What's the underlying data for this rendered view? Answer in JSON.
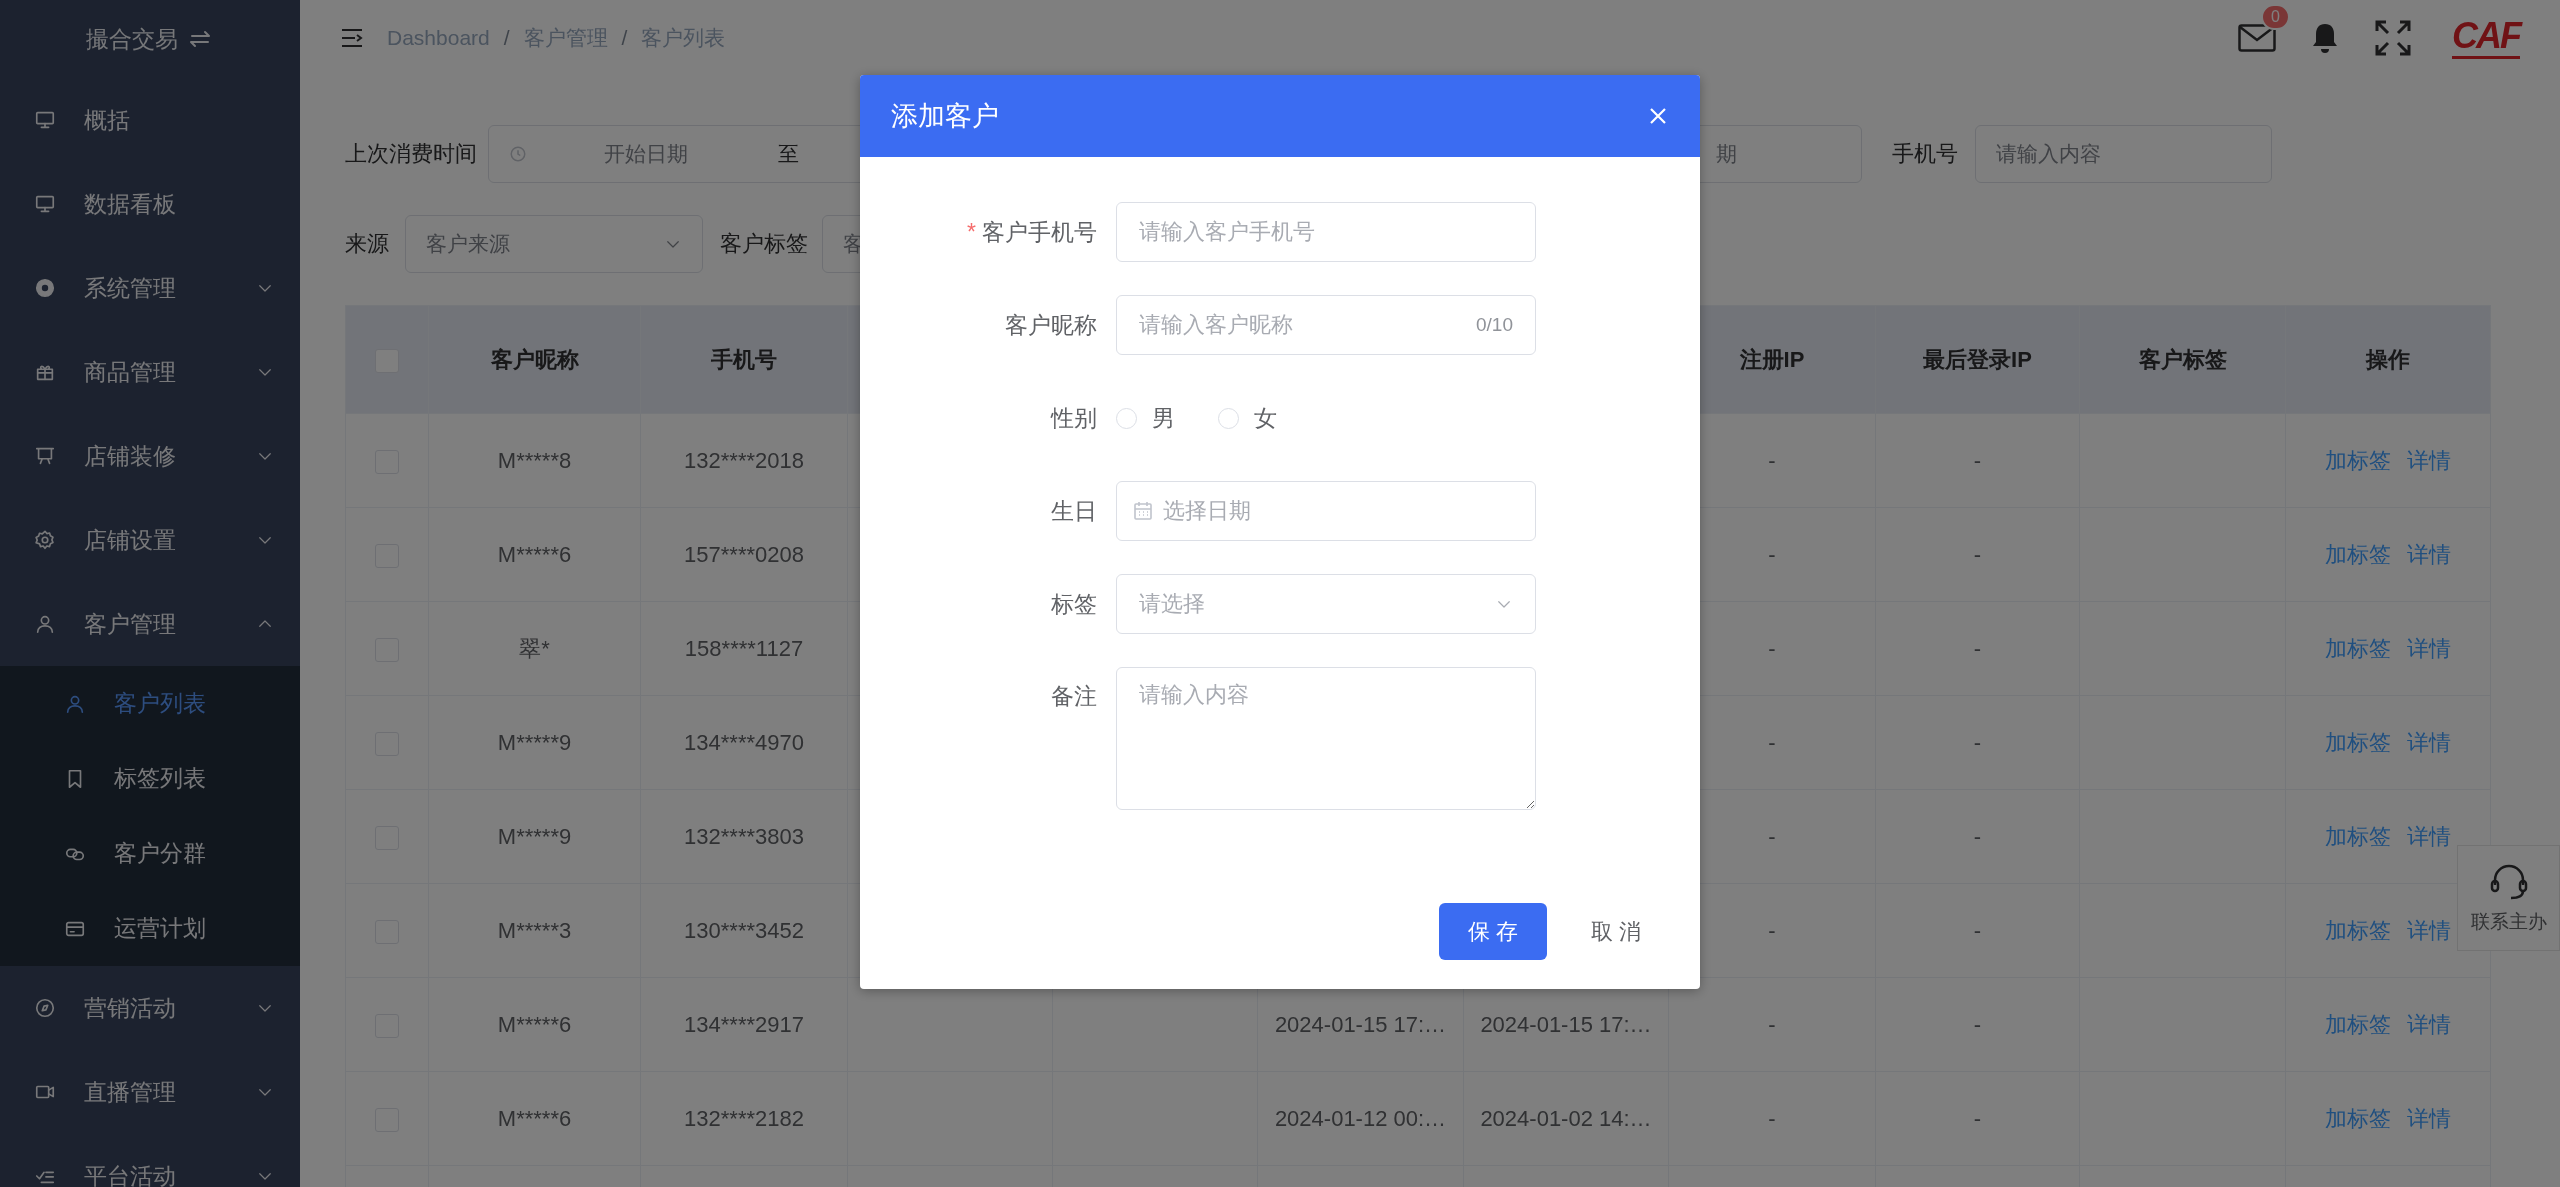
{
  "sidebar": {
    "title": "撮合交易",
    "items": [
      {
        "label": "概括",
        "kind": "link"
      },
      {
        "label": "数据看板",
        "kind": "link"
      },
      {
        "label": "系统管理",
        "kind": "group",
        "expanded": false
      },
      {
        "label": "商品管理",
        "kind": "group",
        "expanded": false
      },
      {
        "label": "店铺装修",
        "kind": "group",
        "expanded": false
      },
      {
        "label": "店铺设置",
        "kind": "group",
        "expanded": false
      },
      {
        "label": "客户管理",
        "kind": "group",
        "expanded": true,
        "children": [
          {
            "label": "客户列表",
            "selected": true
          },
          {
            "label": "标签列表",
            "selected": false
          },
          {
            "label": "客户分群",
            "selected": false
          },
          {
            "label": "运营计划",
            "selected": false
          }
        ]
      },
      {
        "label": "营销活动",
        "kind": "group",
        "expanded": false
      },
      {
        "label": "直播管理",
        "kind": "group",
        "expanded": false
      },
      {
        "label": "平台活动",
        "kind": "group",
        "expanded": false
      }
    ]
  },
  "header": {
    "breadcrumbs": [
      {
        "label": "Dashboard"
      },
      {
        "separator": "/",
        "label": "客户管理"
      },
      {
        "separator": "/",
        "label": "客户列表"
      }
    ],
    "mail_badge": "0",
    "logo": "CAF"
  },
  "filters": [
    [
      {
        "kind": "label",
        "text": "上次消费时间"
      },
      {
        "kind": "date_range",
        "start_placeholder": "开始日期",
        "separator": "至"
      },
      {
        "kind": "partial_field",
        "placeholder": "期"
      },
      {
        "kind": "label",
        "text": "手机号"
      },
      {
        "kind": "input",
        "placeholder": "请输入内容"
      }
    ],
    [
      {
        "kind": "label",
        "text": "来源"
      },
      {
        "kind": "select",
        "placeholder": "客户来源"
      },
      {
        "kind": "label",
        "text": "客户标签"
      },
      {
        "kind": "partial_select",
        "placeholder": "客"
      }
    ]
  ],
  "table": {
    "select_all": {
      "checked": false
    },
    "headers": {
      "nickname": "客户昵称",
      "phone": "手机号",
      "register_ip": "注册IP",
      "last_login_ip": "最后登录IP",
      "tags": "客户标签",
      "actions": "操作"
    },
    "rows": [
      {
        "checked": false,
        "nickname": "M*****8",
        "phone": "132****2018",
        "register_ip": "-",
        "last_login_ip": "-",
        "actions": [
          "加标签",
          "详情"
        ]
      },
      {
        "checked": false,
        "nickname": "M*****6",
        "phone": "157****0208",
        "register_ip": "-",
        "last_login_ip": "-",
        "actions": [
          "加标签",
          "详情"
        ]
      },
      {
        "checked": false,
        "nickname": "翠*",
        "phone": "158****1127",
        "register_ip": "-",
        "last_login_ip": "-",
        "actions": [
          "加标签",
          "详情"
        ]
      },
      {
        "checked": false,
        "nickname": "M*****9",
        "phone": "134****4970",
        "register_ip": "-",
        "last_login_ip": "-",
        "actions": [
          "加标签",
          "详情"
        ]
      },
      {
        "checked": false,
        "nickname": "M*****9",
        "phone": "132****3803",
        "register_ip": "-",
        "last_login_ip": "-",
        "actions": [
          "加标签",
          "详情"
        ]
      },
      {
        "checked": false,
        "nickname": "M*****3",
        "phone": "130****3452",
        "register_ip": "-",
        "last_login_ip": "-",
        "actions": [
          "加标签",
          "详情"
        ]
      },
      {
        "checked": false,
        "nickname": "M*****6",
        "phone": "134****2917",
        "column_5": "2024-01-15 17:…",
        "column_6": "2024-01-15 17:…",
        "register_ip": "-",
        "last_login_ip": "-",
        "actions": [
          "加标签",
          "详情"
        ]
      },
      {
        "checked": false,
        "nickname": "M*****6",
        "phone": "132****2182",
        "column_5": "2024-01-12 00:…",
        "column_6": "2024-01-02 14:…",
        "register_ip": "-",
        "last_login_ip": "-",
        "actions": [
          "加标签",
          "详情"
        ]
      }
    ]
  },
  "contact_widget": {
    "label": "联系主办"
  },
  "dialog": {
    "title": "添加客户",
    "fields": [
      {
        "kind": "text",
        "label": "客户手机号",
        "required_mark": "*",
        "placeholder": "请输入客户手机号"
      },
      {
        "kind": "text",
        "label": "客户昵称",
        "placeholder": "请输入客户昵称",
        "counter": "0/10"
      },
      {
        "kind": "radio",
        "label": "性别",
        "options": [
          {
            "label": "男",
            "selected": false
          },
          {
            "label": "女",
            "selected": false
          }
        ]
      },
      {
        "kind": "date",
        "label": "生日",
        "placeholder": "选择日期"
      },
      {
        "kind": "select",
        "label": "标签",
        "placeholder": "请选择"
      },
      {
        "kind": "textarea",
        "label": "备注",
        "placeholder": "请输入内容"
      }
    ],
    "buttons": [
      {
        "label": "保 存",
        "kind": "primary"
      },
      {
        "label": "取 消",
        "kind": "text"
      }
    ]
  }
}
